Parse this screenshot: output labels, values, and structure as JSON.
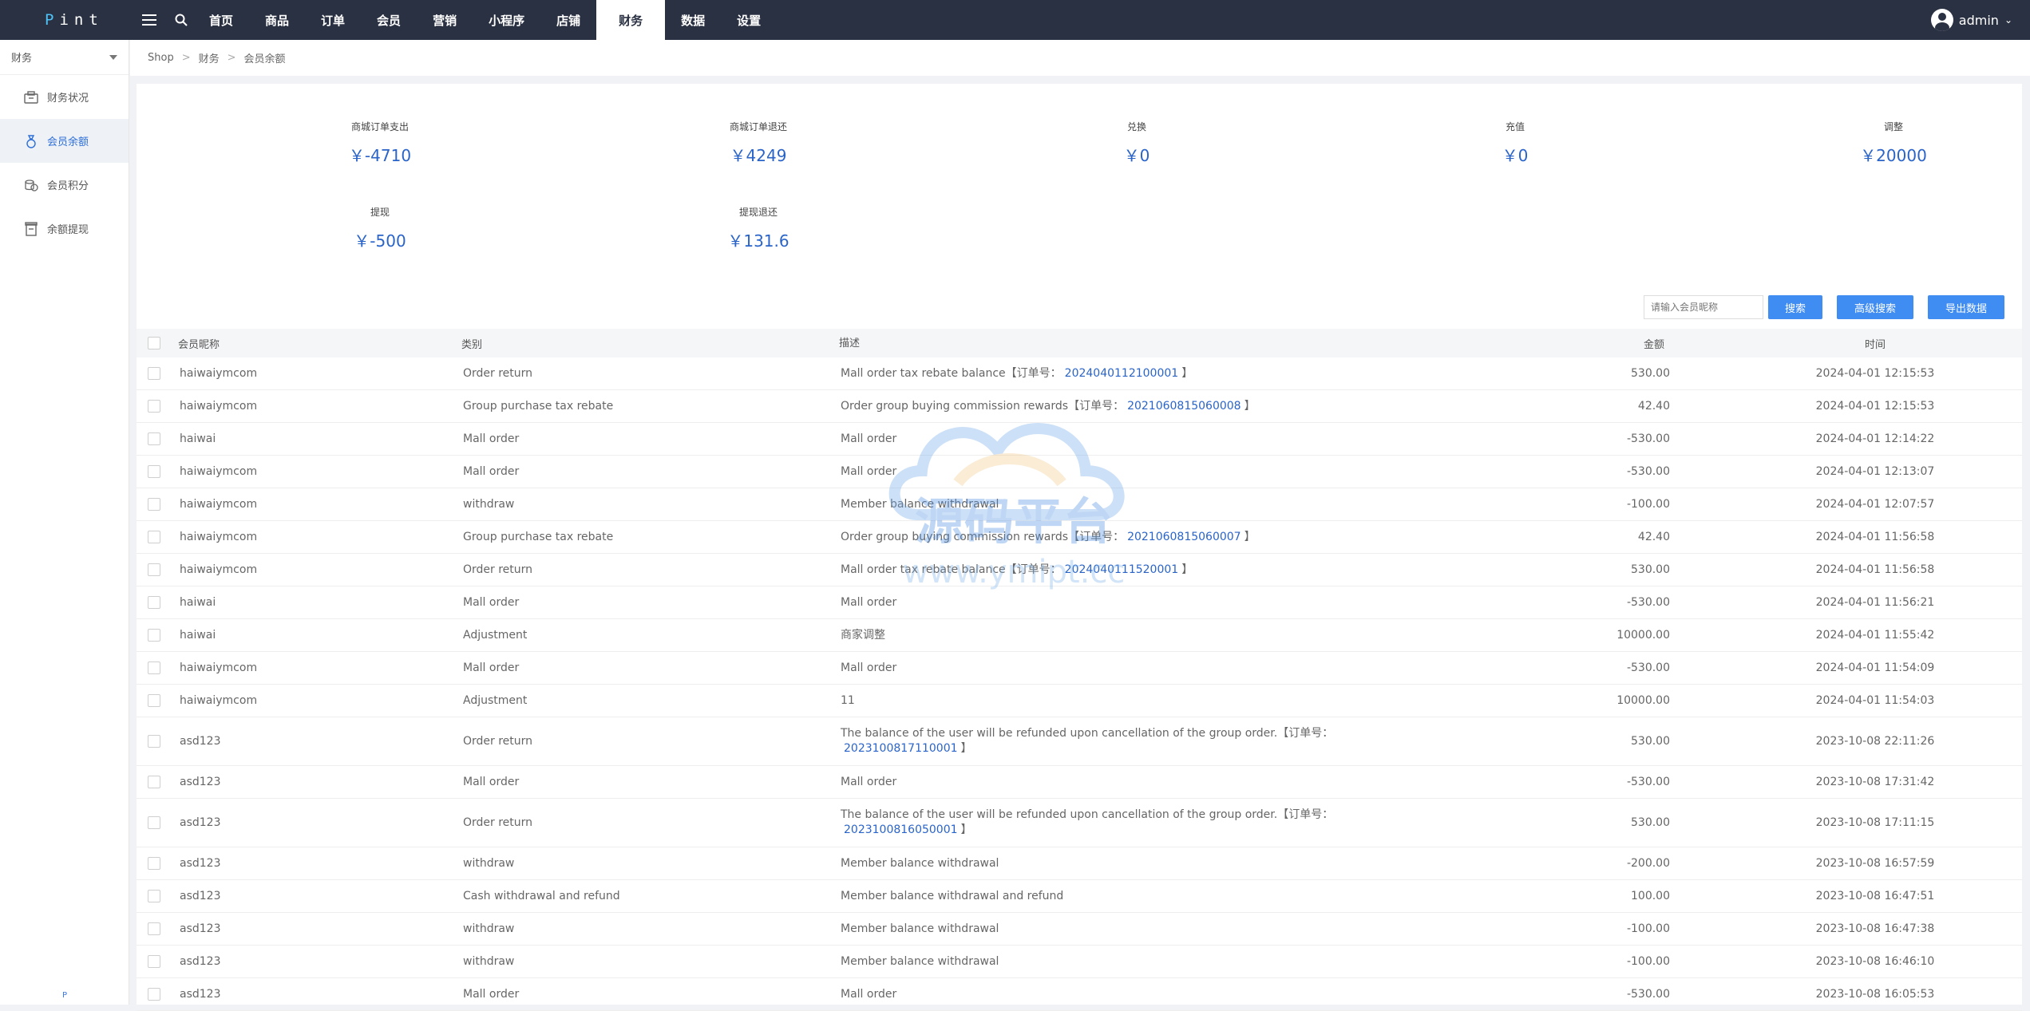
{
  "app": {
    "logo": "Pint",
    "logo_first": "P",
    "logo_rest": "int"
  },
  "nav": {
    "items": [
      "首页",
      "商品",
      "订单",
      "会员",
      "营销",
      "小程序",
      "店铺",
      "财务",
      "数据",
      "设置"
    ],
    "active_index": 7
  },
  "user": {
    "name": "admin"
  },
  "sidebar": {
    "section": "财务",
    "items": [
      {
        "label": "财务状况",
        "icon": "wallet-icon"
      },
      {
        "label": "会员余额",
        "icon": "balance-icon",
        "active": true
      },
      {
        "label": "会员积分",
        "icon": "coins-icon"
      },
      {
        "label": "余额提现",
        "icon": "withdraw-icon"
      }
    ],
    "footer": "P"
  },
  "breadcrumb": [
    "Shop",
    "财务",
    "会员余额"
  ],
  "stats": [
    {
      "label": "商城订单支出",
      "value": "￥-4710"
    },
    {
      "label": "商城订单退还",
      "value": "￥4249"
    },
    {
      "label": "兑换",
      "value": "￥0"
    },
    {
      "label": "充值",
      "value": "￥0"
    },
    {
      "label": "调整",
      "value": "￥20000"
    },
    {
      "label": "提现",
      "value": "￥-500"
    },
    {
      "label": "提现退还",
      "value": "￥131.6"
    }
  ],
  "toolbar": {
    "search_placeholder": "请输入会员昵称",
    "search_button": "搜索",
    "advanced_button": "高级搜索",
    "export_button": "导出数据"
  },
  "table": {
    "headers": {
      "name": "会员昵称",
      "type": "类别",
      "desc": "描述",
      "amount": "金额",
      "time": "时间"
    },
    "rows": [
      {
        "name": "haiwaiymcom",
        "type": "Order return",
        "desc_pre": "Mall order tax rebate balance【订单号：",
        "order": "2024040112100001",
        "desc_post": "】",
        "amount": "530.00",
        "time": "2024-04-01 12:15:53"
      },
      {
        "name": "haiwaiymcom",
        "type": "Group purchase tax rebate",
        "desc_pre": "Order group buying commission rewards【订单号：",
        "order": "2021060815060008",
        "desc_post": "】",
        "amount": "42.40",
        "time": "2024-04-01 12:15:53"
      },
      {
        "name": "haiwai",
        "type": "Mall order",
        "desc_pre": "Mall order",
        "order": "",
        "desc_post": "",
        "amount": "-530.00",
        "time": "2024-04-01 12:14:22"
      },
      {
        "name": "haiwaiymcom",
        "type": "Mall order",
        "desc_pre": "Mall order",
        "order": "",
        "desc_post": "",
        "amount": "-530.00",
        "time": "2024-04-01 12:13:07"
      },
      {
        "name": "haiwaiymcom",
        "type": "withdraw",
        "desc_pre": "Member balance withdrawal",
        "order": "",
        "desc_post": "",
        "amount": "-100.00",
        "time": "2024-04-01 12:07:57"
      },
      {
        "name": "haiwaiymcom",
        "type": "Group purchase tax rebate",
        "desc_pre": "Order group buying commission rewards【订单号：",
        "order": "2021060815060007",
        "desc_post": "】",
        "amount": "42.40",
        "time": "2024-04-01 11:56:58"
      },
      {
        "name": "haiwaiymcom",
        "type": "Order return",
        "desc_pre": "Mall order tax rebate balance【订单号：",
        "order": "2024040111520001",
        "desc_post": "】",
        "amount": "530.00",
        "time": "2024-04-01 11:56:58"
      },
      {
        "name": "haiwai",
        "type": "Mall order",
        "desc_pre": "Mall order",
        "order": "",
        "desc_post": "",
        "amount": "-530.00",
        "time": "2024-04-01 11:56:21"
      },
      {
        "name": "haiwai",
        "type": "Adjustment",
        "desc_pre": "商家调整",
        "order": "",
        "desc_post": "",
        "amount": "10000.00",
        "time": "2024-04-01 11:55:42"
      },
      {
        "name": "haiwaiymcom",
        "type": "Mall order",
        "desc_pre": "Mall order",
        "order": "",
        "desc_post": "",
        "amount": "-530.00",
        "time": "2024-04-01 11:54:09"
      },
      {
        "name": "haiwaiymcom",
        "type": "Adjustment",
        "desc_pre": "11",
        "order": "",
        "desc_post": "",
        "amount": "10000.00",
        "time": "2024-04-01 11:54:03"
      },
      {
        "name": "asd123",
        "type": "Order return",
        "desc_pre": "The balance of the user will be refunded upon cancellation of the group order.【订单号：",
        "order": "2023100817110001",
        "desc_post": "】",
        "amount": "530.00",
        "time": "2023-10-08 22:11:26"
      },
      {
        "name": "asd123",
        "type": "Mall order",
        "desc_pre": "Mall order",
        "order": "",
        "desc_post": "",
        "amount": "-530.00",
        "time": "2023-10-08 17:31:42"
      },
      {
        "name": "asd123",
        "type": "Order return",
        "desc_pre": "The balance of the user will be refunded upon cancellation of the group order.【订单号：",
        "order": "2023100816050001",
        "desc_post": "】",
        "amount": "530.00",
        "time": "2023-10-08 17:11:15"
      },
      {
        "name": "asd123",
        "type": "withdraw",
        "desc_pre": "Member balance withdrawal",
        "order": "",
        "desc_post": "",
        "amount": "-200.00",
        "time": "2023-10-08 16:57:59"
      },
      {
        "name": "asd123",
        "type": "Cash withdrawal and refund",
        "desc_pre": "Member balance withdrawal and refund",
        "order": "",
        "desc_post": "",
        "amount": "100.00",
        "time": "2023-10-08 16:47:51"
      },
      {
        "name": "asd123",
        "type": "withdraw",
        "desc_pre": "Member balance withdrawal",
        "order": "",
        "desc_post": "",
        "amount": "-100.00",
        "time": "2023-10-08 16:47:38"
      },
      {
        "name": "asd123",
        "type": "withdraw",
        "desc_pre": "Member balance withdrawal",
        "order": "",
        "desc_post": "",
        "amount": "-100.00",
        "time": "2023-10-08 16:46:10"
      },
      {
        "name": "asd123",
        "type": "Mall order",
        "desc_pre": "Mall order",
        "order": "",
        "desc_post": "",
        "amount": "-530.00",
        "time": "2023-10-08 16:05:53"
      }
    ]
  },
  "watermark": {
    "title": "源码平台",
    "url": "www.ymipt.cc"
  }
}
